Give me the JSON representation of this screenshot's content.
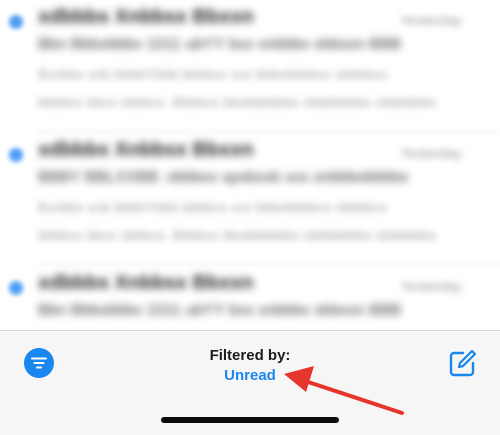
{
  "mail_list": {
    "rows": [
      {
        "sender": "xdbbbs Xnbbsx Bbxxn",
        "date": "Yesterday",
        "subject": "Bbn Bbbxbbbx 1011 ubYY bxx xnbbbx xbbxxn BBB",
        "preview1": "Bxxbbx xnb bbbbYbbb bbbbxx xxx bbbxbbbbxx xbbbbxx",
        "preview2": "bbbbxx bbxx xbbbxx. Bbbbxx bbxbbbbbbx xbbbbbbbx xbbbbbbx"
      },
      {
        "sender": "xdbbbs Xnbbsx Bbxxn",
        "date": "Yesterday",
        "subject": "BBBY BBLXXBB: xbbbxx xpxbxxb xxx xnbbbxbbbbx",
        "preview1": "Bxxbbx xnb bbbbYbbb bbbbxx xxx bbbxbbbbxx xbbbbxx",
        "preview2": "bbbbxx bbxx xbbbxx. Bbbbxx bbxbbbbbbx xbbbbbbbx xbbbbbbx"
      },
      {
        "sender": "xdbbbs Xnbbsx Bbxxn",
        "date": "Yesterday",
        "subject": "Bbn Bbbxbbbx 1011 ubYY bxx xnbbbx xbbxxn BBB",
        "preview1": "",
        "preview2": ""
      }
    ]
  },
  "toolbar": {
    "filter_button_icon": "filter-lines-icon",
    "filtered_label": "Filtered by:",
    "filter_value": "Unread",
    "compose_icon": "compose-icon"
  },
  "colors": {
    "accent": "#1a86f0",
    "annotation": "#e8352b"
  }
}
